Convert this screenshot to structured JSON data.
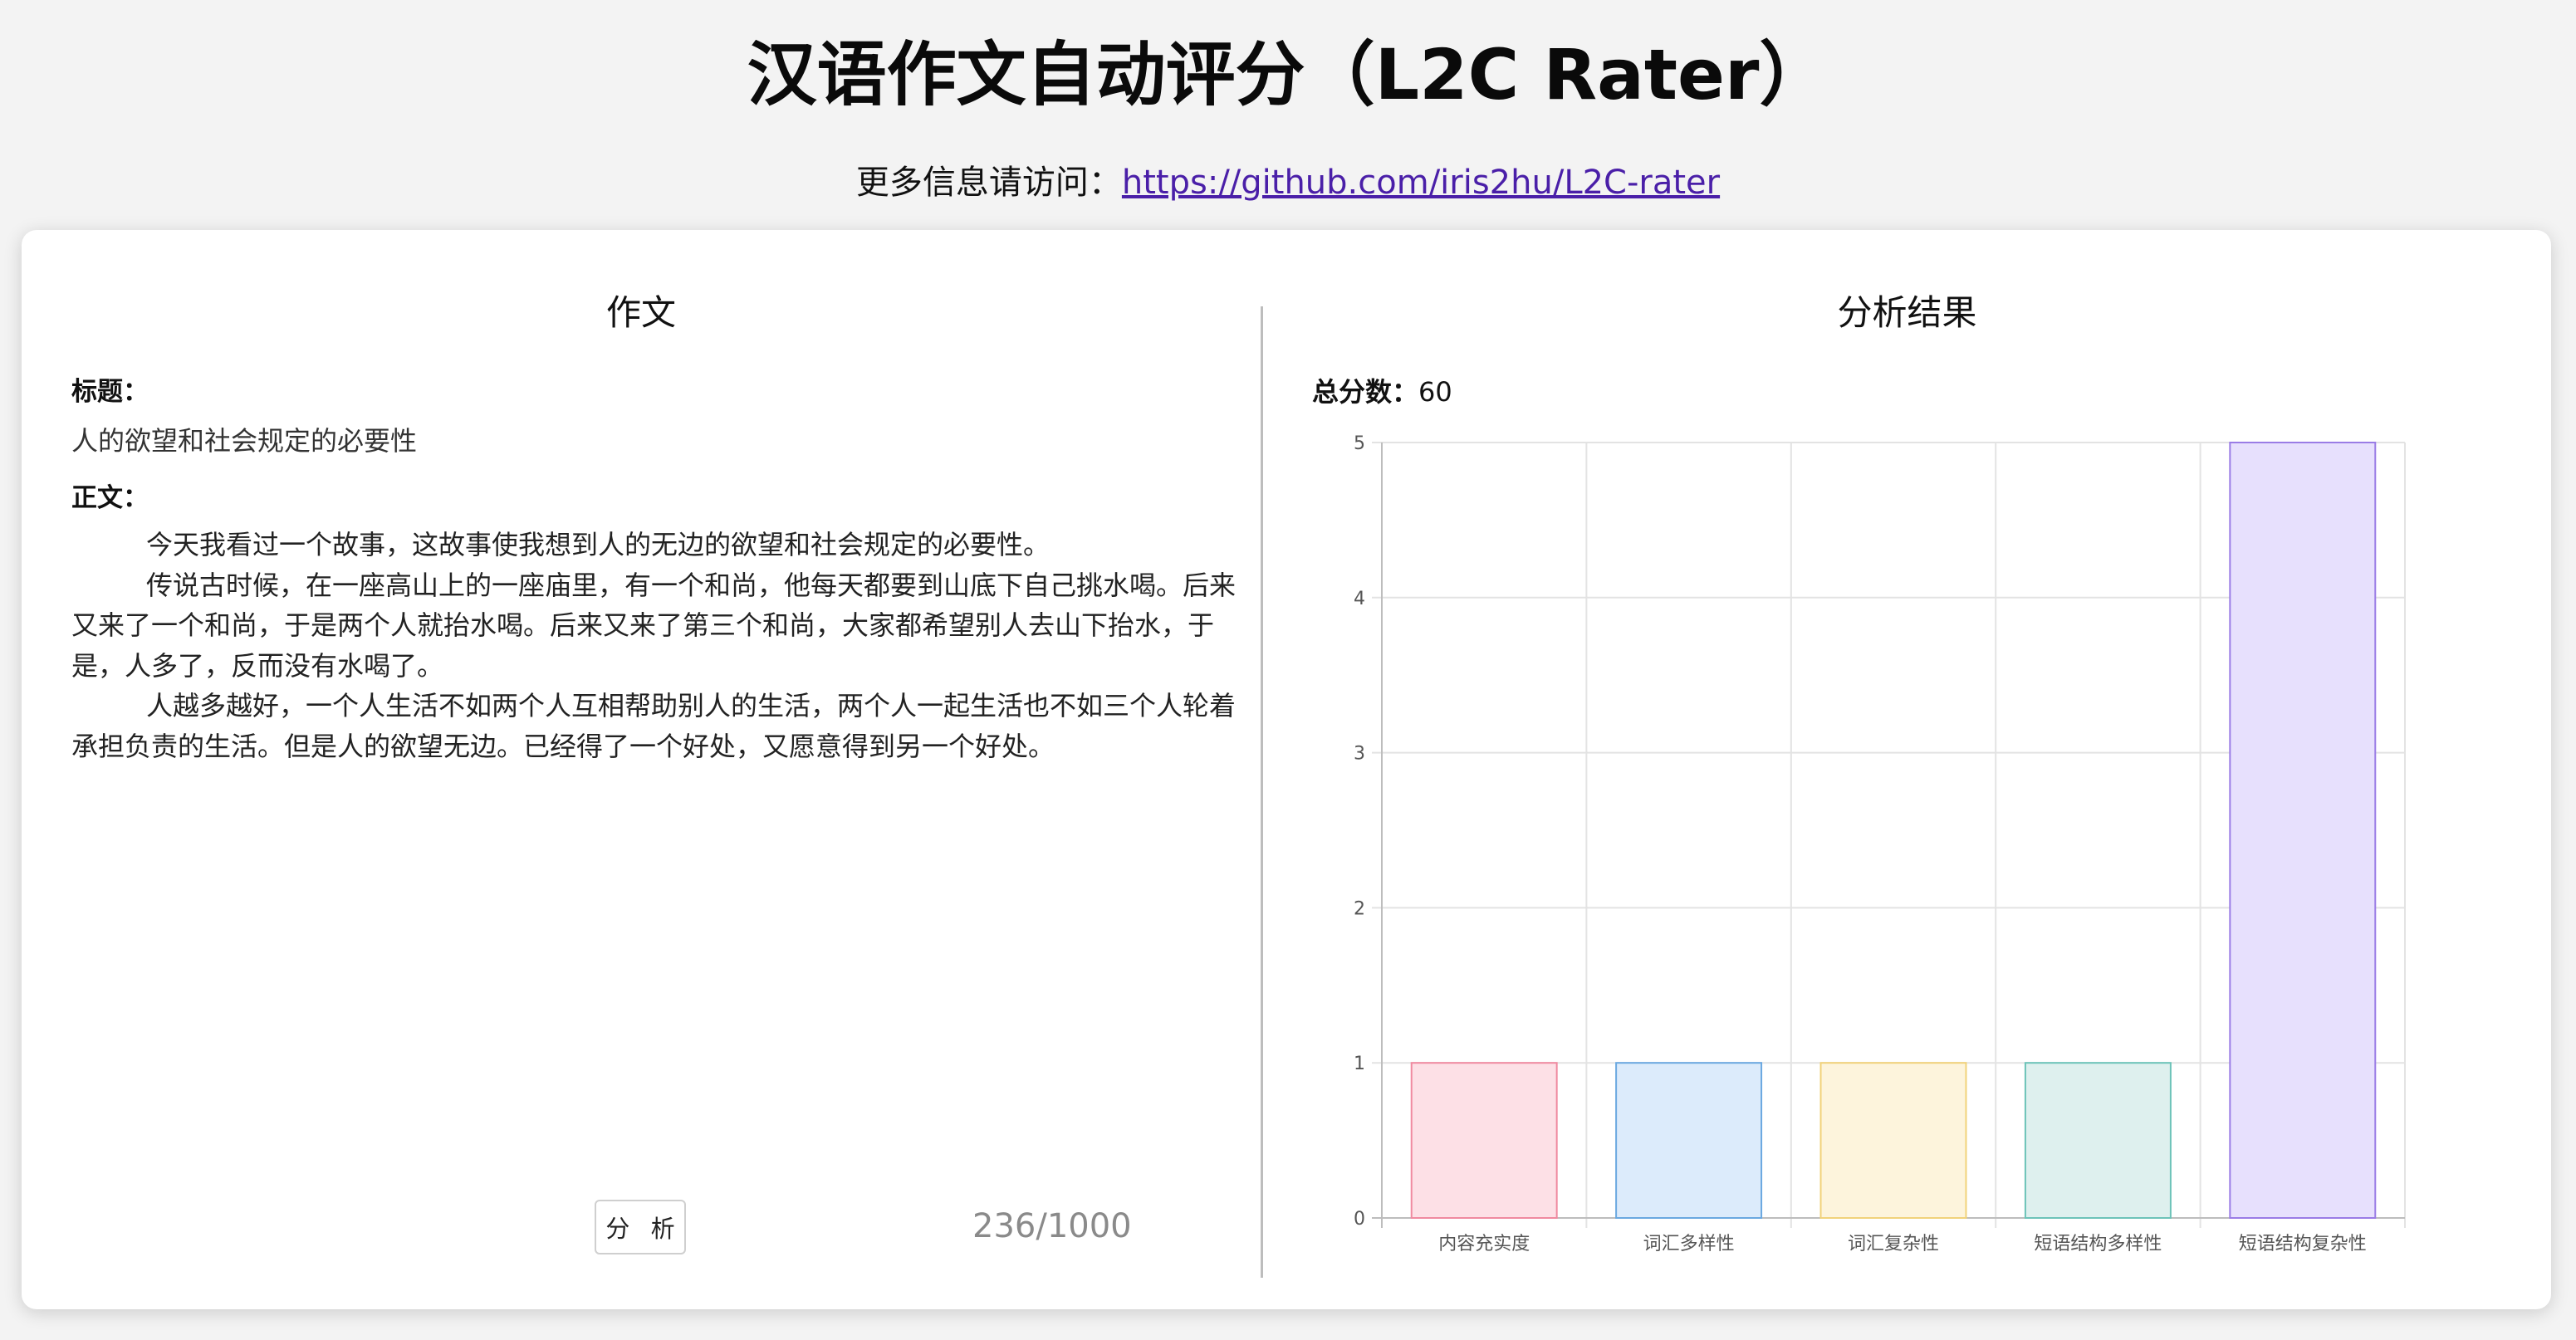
{
  "header": {
    "title": "汉语作文自动评分（L2C Rater）",
    "more_info_prefix": "更多信息请访问：",
    "link_text": "https://github.com/iris2hu/L2C-rater"
  },
  "essay_panel": {
    "heading": "作文",
    "title_label": "标题：",
    "title_value": "人的欲望和社会规定的必要性",
    "body_label": "正文：",
    "paragraphs": [
      "今天我看过一个故事，这故事使我想到人的无边的欲望和社会规定的必要性。",
      "传说古时候，在一座高山上的一座庙里，有一个和尚，他每天都要到山底下自己挑水喝。后来又来了一个和尚，于是两个人就抬水喝。后来又来了第三个和尚，大家都希望别人去山下抬水，于是，人多了，反而没有水喝了。",
      "人越多越好，一个人生活不如两个人互相帮助别人的生活，两个人一起生活也不如三个人轮着承担负责的生活。但是人的欲望无边。已经得了一个好处，又愿意得到另一个好处。"
    ],
    "analyze_button": "分 析",
    "char_count": "236/1000"
  },
  "result_panel": {
    "heading": "分析结果",
    "total_label": "总分数：",
    "total_value": "60"
  },
  "chart_data": {
    "type": "bar",
    "categories": [
      "内容充实度",
      "词汇多样性",
      "词汇复杂性",
      "短语结构多样性",
      "短语结构复杂性"
    ],
    "values": [
      1,
      1,
      1,
      1,
      5
    ],
    "ylim": [
      0,
      5
    ],
    "yticks": [
      "0",
      "1",
      "2",
      "3",
      "4",
      "5"
    ],
    "grid": true,
    "legend": "none",
    "colors": [
      {
        "fill": "#fde0e6",
        "stroke": "#f08aa0"
      },
      {
        "fill": "#dcebfb",
        "stroke": "#6aa8e0"
      },
      {
        "fill": "#fdf4dc",
        "stroke": "#f1d27a"
      },
      {
        "fill": "#def0ee",
        "stroke": "#6cc3b8"
      },
      {
        "fill": "#e7e0fd",
        "stroke": "#9a7ce6"
      }
    ]
  }
}
